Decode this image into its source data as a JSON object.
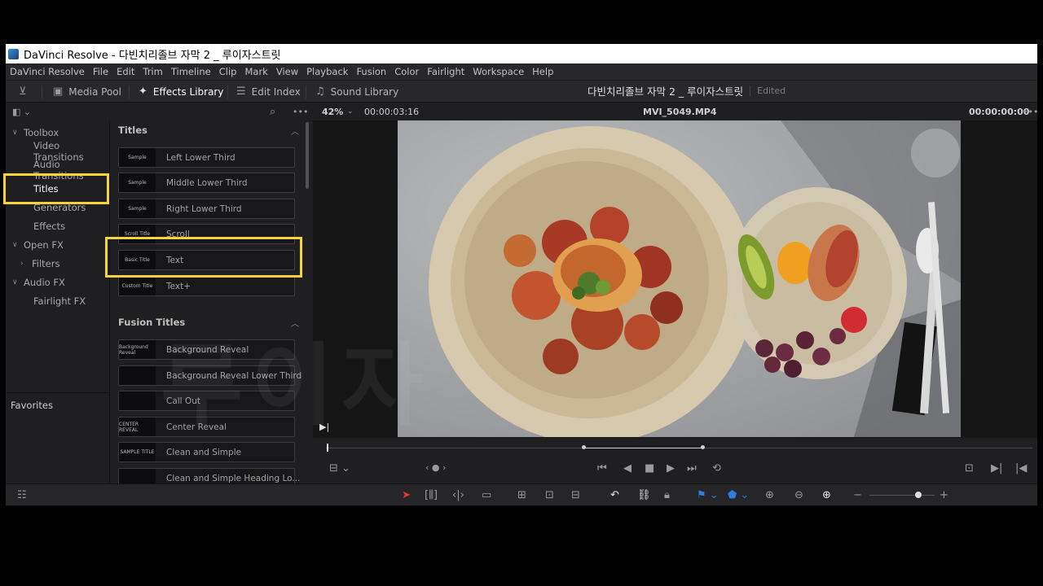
{
  "window": {
    "title": "DaVinci Resolve - 다빈치리졸브 자막 2 _ 루이자스트릿"
  },
  "menubar": [
    "DaVinci Resolve",
    "File",
    "Edit",
    "Trim",
    "Timeline",
    "Clip",
    "Mark",
    "View",
    "Playback",
    "Fusion",
    "Color",
    "Fairlight",
    "Workspace",
    "Help"
  ],
  "toolbar": {
    "media_pool": "Media Pool",
    "effects_library": "Effects Library",
    "edit_index": "Edit Index",
    "sound_library": "Sound Library",
    "project_title": "다빈치리졸브 자막 2 _ 루이자스트릿",
    "status": "Edited"
  },
  "viewer": {
    "zoom": "42%",
    "source_timecode": "00:00:03:16",
    "clip_name": "MVI_5049.MP4",
    "record_timecode": "00:00:00:00"
  },
  "tree": {
    "toolbox": "Toolbox",
    "video_transitions": "Video Transitions",
    "audio_transitions": "Audio Transitions",
    "titles": "Titles",
    "generators": "Generators",
    "effects": "Effects",
    "open_fx": "Open FX",
    "filters": "Filters",
    "audio_fx": "Audio FX",
    "fairlight_fx": "Fairlight FX",
    "favorites": "Favorites"
  },
  "titles_section": {
    "header": "Titles",
    "items": [
      {
        "label": "Left Lower Third",
        "thumb": "Sample"
      },
      {
        "label": "Middle Lower Third",
        "thumb": "Sample"
      },
      {
        "label": "Right Lower Third",
        "thumb": "Sample"
      },
      {
        "label": "Scroll",
        "thumb": "Scroll Title"
      },
      {
        "label": "Text",
        "thumb": "Basic Title"
      },
      {
        "label": "Text+",
        "thumb": "Custom Title"
      }
    ]
  },
  "fusion_section": {
    "header": "Fusion Titles",
    "items": [
      {
        "label": "Background Reveal",
        "thumb": "Background Reveal"
      },
      {
        "label": "Background Reveal Lower Third",
        "thumb": ""
      },
      {
        "label": "Call Out",
        "thumb": ""
      },
      {
        "label": "Center Reveal",
        "thumb": "CENTER REVEAL"
      },
      {
        "label": "Clean and Simple",
        "thumb": "SAMPLE TITLE"
      },
      {
        "label": "Clean and Simple Heading Lo...",
        "thumb": ""
      }
    ]
  },
  "watermark": "루이자",
  "highlight_color": "#f5d33c"
}
